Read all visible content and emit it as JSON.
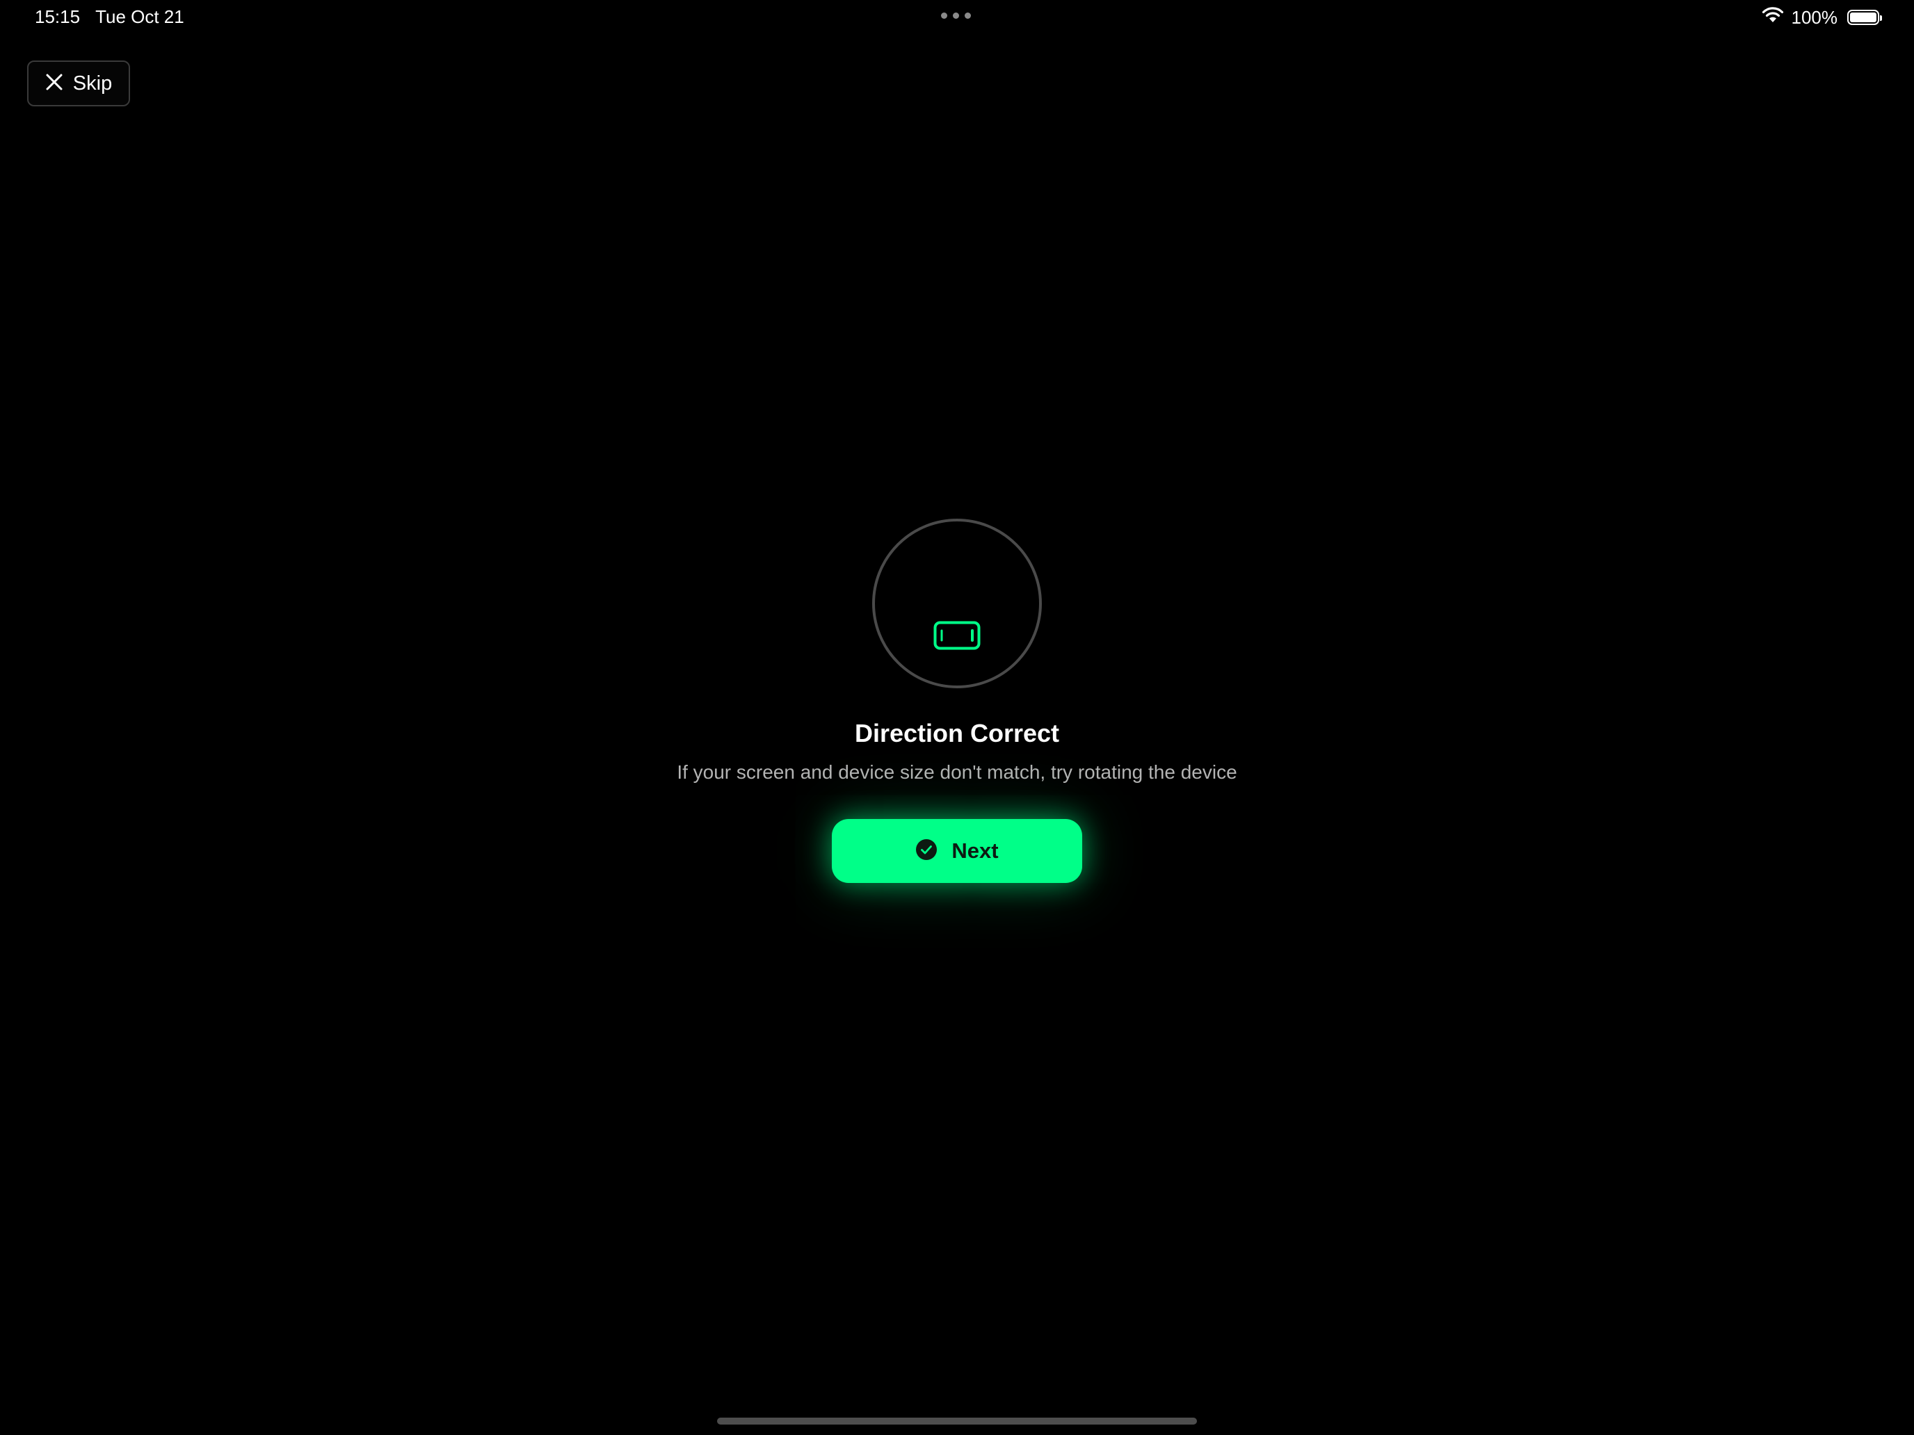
{
  "status_bar": {
    "time": "15:15",
    "date": "Tue Oct 21",
    "battery_percent": "100%",
    "battery_level": 1.0
  },
  "skip": {
    "label": "Skip",
    "icon": "close-icon"
  },
  "orientation": {
    "icon": "landscape-device-icon",
    "title": "Direction Correct",
    "subtitle": "If your screen and device size don't match, try rotating the device"
  },
  "next": {
    "label": "Next",
    "icon": "checkmark-circle-icon"
  },
  "colors": {
    "accent": "#00ff88",
    "background": "#000000",
    "subtitle": "#b3b3b3"
  }
}
